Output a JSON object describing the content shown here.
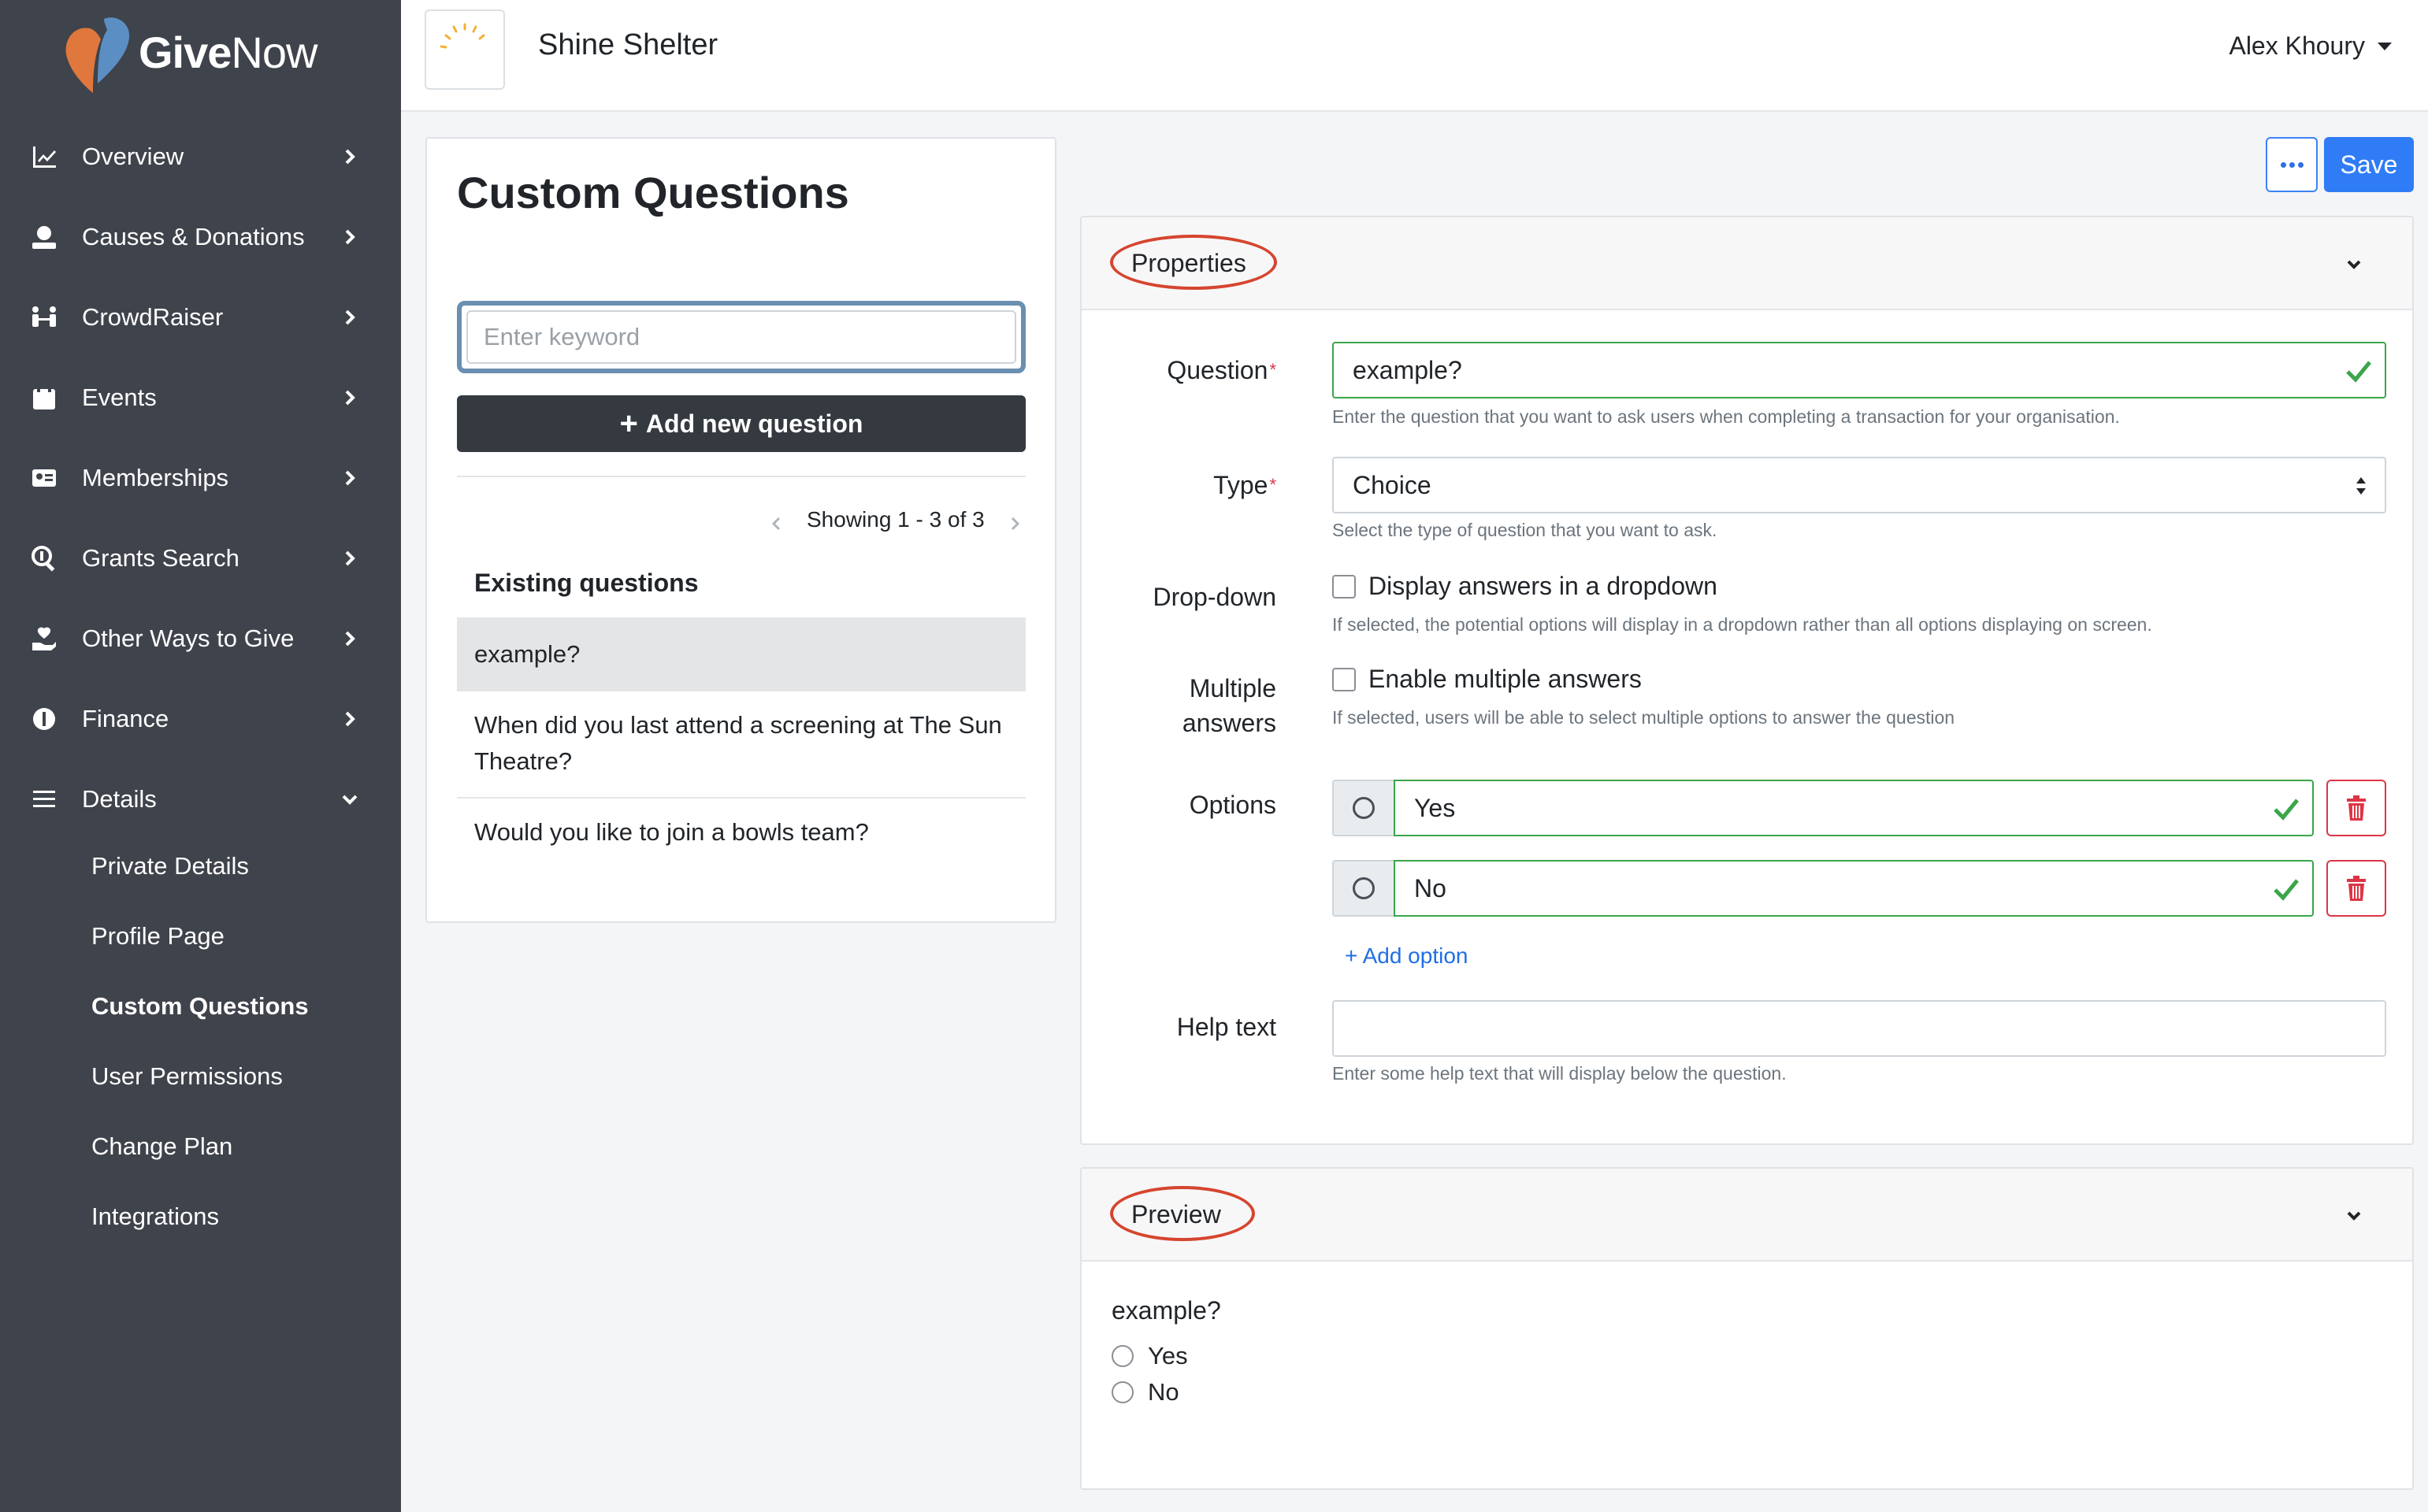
{
  "brand": {
    "name_bold": "Give",
    "name_light": "Now",
    "accent": "#e0773c"
  },
  "sidebar": {
    "items": [
      {
        "label": "Overview",
        "icon": "chart-line-icon"
      },
      {
        "label": "Causes & Donations",
        "icon": "donate-icon"
      },
      {
        "label": "CrowdRaiser",
        "icon": "people-link-icon"
      },
      {
        "label": "Events",
        "icon": "calendar-icon"
      },
      {
        "label": "Memberships",
        "icon": "id-card-icon"
      },
      {
        "label": "Grants Search",
        "icon": "search-dollar-icon"
      },
      {
        "label": "Other Ways to Give",
        "icon": "hand-heart-icon"
      },
      {
        "label": "Finance",
        "icon": "coin-icon"
      },
      {
        "label": "Details",
        "icon": "list-icon"
      }
    ],
    "sub_items": [
      {
        "label": "Private Details"
      },
      {
        "label": "Profile Page"
      },
      {
        "label": "Custom Questions"
      },
      {
        "label": "User Permissions"
      },
      {
        "label": "Change Plan"
      },
      {
        "label": "Integrations"
      }
    ]
  },
  "header": {
    "org_name": "Shine Shelter",
    "user_name": "Alex Khoury"
  },
  "list_panel": {
    "title": "Custom Questions",
    "search_placeholder": "Enter keyword",
    "add_button": "Add new question",
    "pager": "Showing 1 - 3 of 3",
    "existing_heading": "Existing questions",
    "questions": [
      {
        "text": "example?"
      },
      {
        "text": "When did you last attend a screening at The Sun Theatre?"
      },
      {
        "text": "Would you like to join a bowls team?"
      }
    ]
  },
  "toolbar": {
    "save_label": "Save"
  },
  "properties": {
    "title": "Properties",
    "question_label": "Question",
    "question_value": "example?",
    "question_help": "Enter the question that you want to ask users when completing a transaction for your organisation.",
    "type_label": "Type",
    "type_value": "Choice",
    "type_help": "Select the type of question that you want to ask.",
    "dropdown_label": "Drop-down",
    "dropdown_checkbox": "Display answers in a dropdown",
    "dropdown_help": "If selected, the potential options will display in a dropdown rather than all options displaying on screen.",
    "multiple_label_1": "Multiple",
    "multiple_label_2": "answers",
    "multiple_checkbox": "Enable multiple answers",
    "multiple_help": "If selected, users will be able to select multiple options to answer the question",
    "options_label": "Options",
    "options": [
      {
        "value": "Yes"
      },
      {
        "value": "No"
      }
    ],
    "add_option": "+ Add option",
    "help_label": "Help text",
    "help_value": "",
    "help_help": "Enter some help text that will display below the question."
  },
  "preview": {
    "title": "Preview",
    "question": "example?",
    "options": [
      {
        "label": "Yes"
      },
      {
        "label": "No"
      }
    ]
  },
  "colors": {
    "sidebar_bg": "#3f434b",
    "primary": "#2f7cf6",
    "valid": "#3aa54a",
    "danger": "#dc3545",
    "annotation": "#d6452e"
  }
}
